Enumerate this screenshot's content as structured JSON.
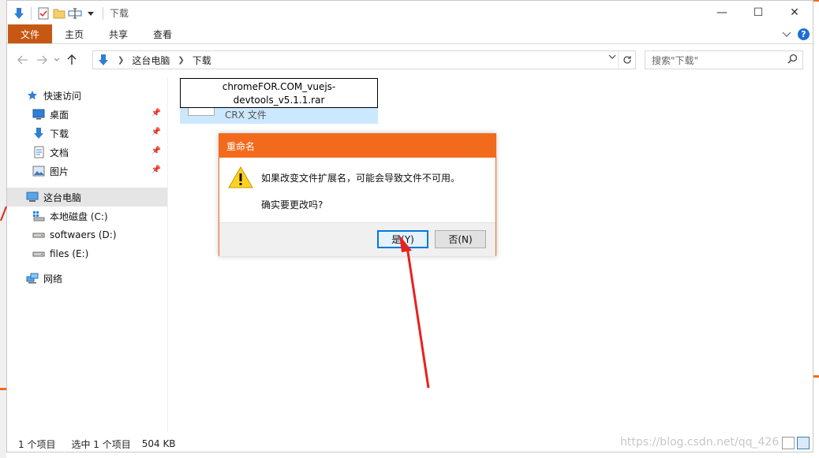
{
  "window": {
    "title": "下载"
  },
  "window_controls": {
    "minimize": "—",
    "maximize": "☐",
    "close": "✕"
  },
  "ribbon": {
    "tabs": [
      "文件",
      "主页",
      "共享",
      "查看"
    ],
    "help": "?"
  },
  "address": {
    "crumbs": [
      "这台电脑",
      "下载"
    ],
    "search_placeholder": "搜索\"下载\""
  },
  "nav_pane": {
    "quick_access": "快速访问",
    "items": [
      {
        "label": "桌面",
        "pinned": true
      },
      {
        "label": "下载",
        "pinned": true
      },
      {
        "label": "文档",
        "pinned": true
      },
      {
        "label": "图片",
        "pinned": true
      }
    ],
    "this_pc": "这台电脑",
    "drives": [
      "本地磁盘 (C:)",
      "softwaers (D:)",
      "files (E:)"
    ],
    "network": "网络"
  },
  "file": {
    "rename_line1": "chromeFOR.COM_vuejs-",
    "rename_line2": "devtools_v5.1.1.rar",
    "type": "CRX 文件"
  },
  "status_bar": {
    "item_count": "1 个项目",
    "selected": "选中 1 个项目",
    "size": "504 KB"
  },
  "dialog": {
    "title": "重命名",
    "message": "如果改变文件扩展名，可能会导致文件不可用。",
    "question": "确实要更改吗?",
    "yes_label": "是(Y)",
    "no_label": "否(N)"
  },
  "watermark": "https://blog.csdn.net/qq_426",
  "colors": {
    "accent_orange": "#f26b1d",
    "file_tab": "#c75813",
    "selection_blue": "#cce8ff",
    "annotation_red": "#e8211f"
  }
}
